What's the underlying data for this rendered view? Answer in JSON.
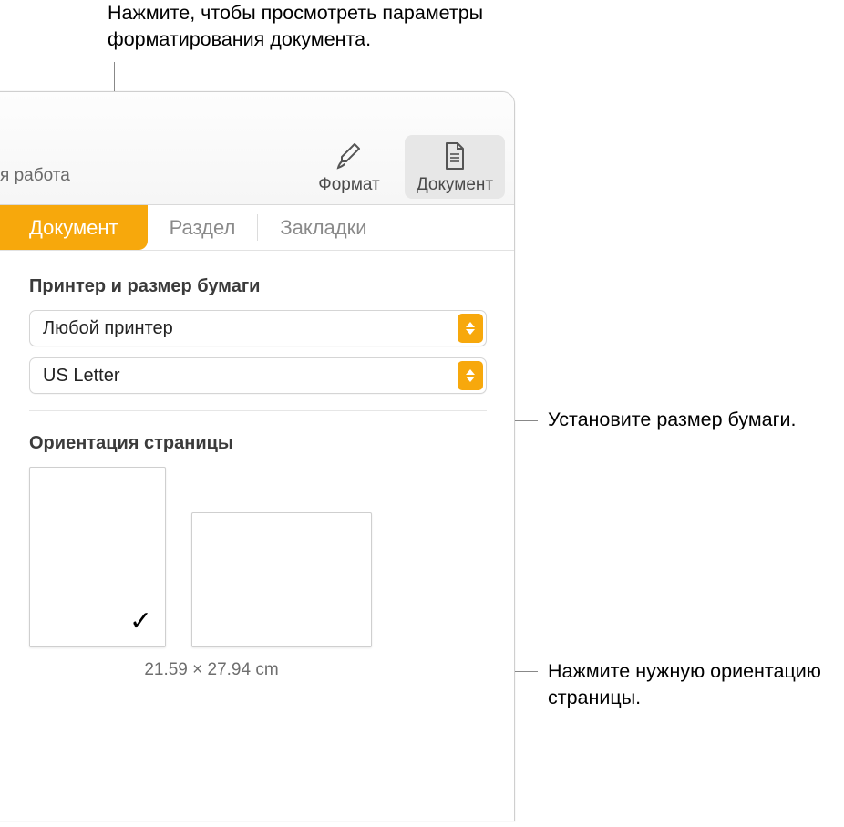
{
  "callouts": {
    "top": "Нажмите, чтобы просмотреть параметры форматирования документа.",
    "paper": "Установите размер бумаги.",
    "orient": "Нажмите нужную ориентацию страницы."
  },
  "toolbar": {
    "left_fragment": "я работа",
    "format_label": "Формат",
    "document_label": "Документ"
  },
  "tabs": {
    "document": "Документ",
    "section": "Раздел",
    "bookmarks": "Закладки"
  },
  "printer_section": {
    "title": "Принтер и размер бумаги",
    "printer_value": "Любой принтер",
    "paper_value": "US Letter"
  },
  "orientation_section": {
    "title": "Ориентация страницы",
    "dimensions": "21.59 × 27.94 cm"
  }
}
